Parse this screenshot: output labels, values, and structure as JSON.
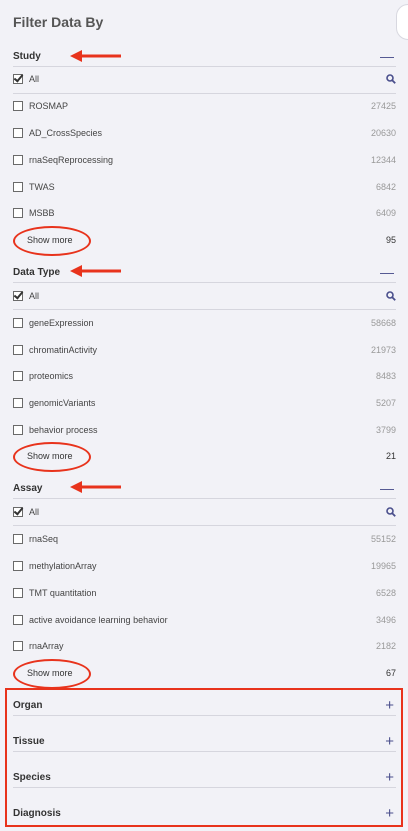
{
  "title": "Filter Data By",
  "search_icon": "search-icon",
  "annotation_color": "#e8331c",
  "accent_color": "#4a4f8c",
  "study": {
    "label": "Study",
    "toggle": "—",
    "all_label": "All",
    "items": [
      {
        "name": "ROSMAP",
        "count": "27425"
      },
      {
        "name": "AD_CrossSpecies",
        "count": "20630"
      },
      {
        "name": "rnaSeqReprocessing",
        "count": "12344"
      },
      {
        "name": "TWAS",
        "count": "6842"
      },
      {
        "name": "MSBB",
        "count": "6409"
      }
    ],
    "show_more": "Show more",
    "more_count": "95"
  },
  "data_type": {
    "label": "Data Type",
    "toggle": "—",
    "all_label": "All",
    "items": [
      {
        "name": "geneExpression",
        "count": "58668"
      },
      {
        "name": "chromatinActivity",
        "count": "21973"
      },
      {
        "name": "proteomics",
        "count": "8483"
      },
      {
        "name": "genomicVariants",
        "count": "5207"
      },
      {
        "name": "behavior process",
        "count": "3799"
      }
    ],
    "show_more": "Show more",
    "more_count": "21"
  },
  "assay": {
    "label": "Assay",
    "toggle": "—",
    "all_label": "All",
    "items": [
      {
        "name": "rnaSeq",
        "count": "55152"
      },
      {
        "name": "methylationArray",
        "count": "19965"
      },
      {
        "name": "TMT quantitation",
        "count": "6528"
      },
      {
        "name": "active avoidance learning behavior",
        "count": "3496"
      },
      {
        "name": "rnaArray",
        "count": "2182"
      }
    ],
    "show_more": "Show more",
    "more_count": "67"
  },
  "collapsed": [
    {
      "label": "Organ",
      "toggle": "+"
    },
    {
      "label": "Tissue",
      "toggle": "+"
    },
    {
      "label": "Species",
      "toggle": "+"
    },
    {
      "label": "Diagnosis",
      "toggle": "+"
    }
  ]
}
